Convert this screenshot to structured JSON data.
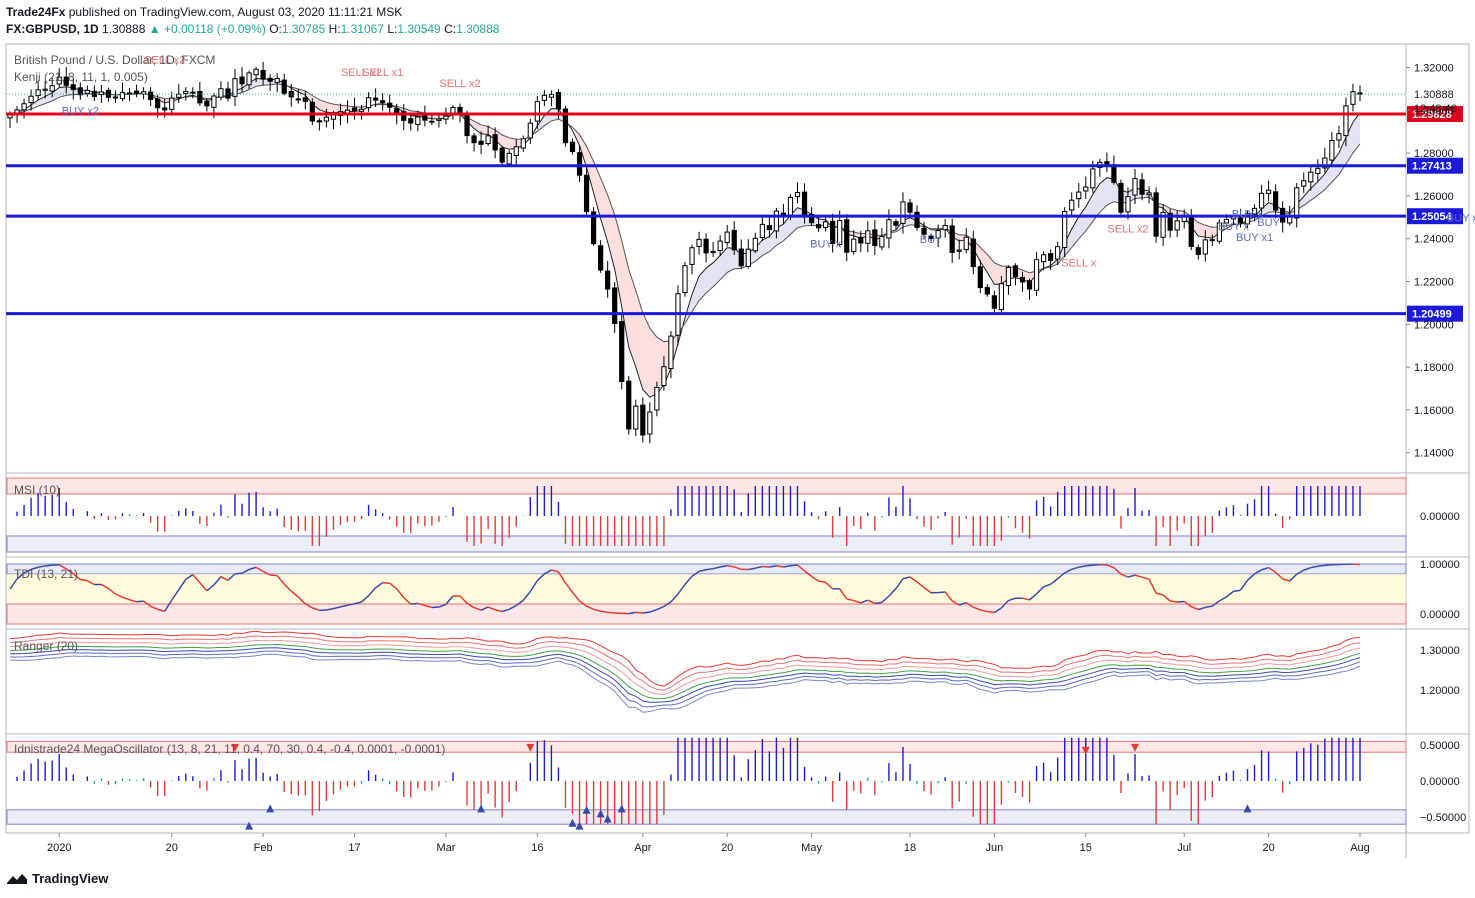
{
  "header": {
    "publisher": "Trade24Fx",
    "publish_text": "published on TradingView.com, August 03, 2020 11:11:21 MSK",
    "symbol": "FX:GBPUSD, 1D",
    "last": "1.30888",
    "change": "▲ +0.00118 (+0.09%)",
    "o_label": "O:",
    "o": "1.30785",
    "h_label": "H:",
    "h": "1.31067",
    "l_label": "L:",
    "l": "1.30549",
    "c_label": "C:",
    "c": "1.30888"
  },
  "main_pane": {
    "title": "British Pound / U.S. Dollar, 1D, FXCM",
    "indicator": "Kenji (21, 8, 11, 1, 0.005)",
    "countdown": "12:48:46"
  },
  "footer": {
    "brand": "TradingView"
  },
  "colors": {
    "up": "#26a69a",
    "red": "#e53935",
    "blue": "#1a1ad8",
    "candle": "#000000",
    "price_tag": "#1a1ad8",
    "red_tag": "#e0001b"
  },
  "chart_data": {
    "type": "candlestick",
    "symbol": "GBPUSD",
    "x_ticks": [
      "2020",
      "20",
      "Feb",
      "17",
      "Mar",
      "16",
      "Apr",
      "20",
      "May",
      "18",
      "Jun",
      "15",
      "Jul",
      "20",
      "Aug"
    ],
    "y_ticks": [
      "1.32000",
      "1.30000",
      "1.28000",
      "1.26000",
      "1.24000",
      "1.22000",
      "1.20000",
      "1.18000",
      "1.16000",
      "1.14000"
    ],
    "y_tick_values": [
      1.32,
      1.3,
      1.28,
      1.26,
      1.24,
      1.22,
      1.2,
      1.18,
      1.16,
      1.14
    ],
    "ylim": [
      1.131,
      1.331
    ],
    "current_price": "1.30888",
    "levels": [
      {
        "value": 1.29828,
        "label": "1.29828",
        "color": "#e0001b"
      },
      {
        "value": 1.27413,
        "label": "1.27413",
        "color": "#1a1ad8"
      },
      {
        "value": 1.25054,
        "label": "1.25054",
        "color": "#1a1ad8"
      },
      {
        "value": 1.20499,
        "label": "1.20499",
        "color": "#1a1ad8"
      }
    ],
    "signals": [
      {
        "text": "SELL x2",
        "i": 22,
        "price": 1.322,
        "color": "#e57373"
      },
      {
        "text": "SELL x2",
        "i": 50,
        "price": 1.316,
        "color": "#e57373"
      },
      {
        "text": "SELL x1",
        "i": 53,
        "price": 1.316,
        "color": "#e57373"
      },
      {
        "text": "SELL x2",
        "i": 64,
        "price": 1.311,
        "color": "#e57373"
      },
      {
        "text": "BUY x2",
        "i": 10,
        "price": 1.298,
        "color": "#5c6bc0"
      },
      {
        "text": "BUY x",
        "i": 116,
        "price": 1.236,
        "color": "#5c6bc0"
      },
      {
        "text": "BUY",
        "i": 131,
        "price": 1.238,
        "color": "#5c6bc0"
      },
      {
        "text": "SELL x2",
        "i": 159,
        "price": 1.243,
        "color": "#e57373"
      },
      {
        "text": "SELL x",
        "i": 152,
        "price": 1.227,
        "color": "#e57373"
      },
      {
        "text": "BUY x",
        "i": 174,
        "price": 1.244,
        "color": "#5c6bc0"
      },
      {
        "text": "BUY x",
        "i": 176,
        "price": 1.25,
        "color": "#5c6bc0"
      },
      {
        "text": "BUY",
        "i": 179,
        "price": 1.246,
        "color": "#5c6bc0"
      },
      {
        "text": "BUY x1",
        "i": 177,
        "price": 1.239,
        "color": "#5c6bc0"
      },
      {
        "text": "BUY x1",
        "i": 207,
        "price": 1.248,
        "color": "#5c6bc0"
      },
      {
        "text": "BUY x1",
        "i": 211,
        "price": 1.244,
        "color": "#5c6bc0"
      }
    ],
    "closes": [
      1.2985,
      1.3002,
      1.3031,
      1.3066,
      1.3096,
      1.3099,
      1.3115,
      1.3155,
      1.3117,
      1.3097,
      1.3073,
      1.3093,
      1.3065,
      1.3086,
      1.3061,
      1.3061,
      1.3083,
      1.3081,
      1.3078,
      1.3087,
      1.3051,
      1.3012,
      1.3002,
      1.3057,
      1.3075,
      1.3088,
      1.3082,
      1.3035,
      1.3021,
      1.3067,
      1.3101,
      1.3057,
      1.3148,
      1.3124,
      1.3175,
      1.3192,
      1.3146,
      1.3136,
      1.3149,
      1.308,
      1.3063,
      1.3049,
      1.3042,
      1.295,
      1.2946,
      1.2968,
      1.2983,
      1.2994,
      1.3001,
      1.2997,
      1.3005,
      1.3059,
      1.3048,
      1.3037,
      1.3014,
      1.2984,
      1.2953,
      1.2941,
      1.2969,
      1.2954,
      1.2949,
      1.2959,
      1.2973,
      1.3013,
      1.2983,
      1.2882,
      1.2849,
      1.2841,
      1.2881,
      1.2815,
      1.2758,
      1.2799,
      1.283,
      1.2867,
      1.294,
      1.3041,
      1.307,
      1.3074,
      1.3006,
      1.2849,
      1.2807,
      1.2697,
      1.2527,
      1.2377,
      1.2254,
      1.2165,
      1.2004,
      1.1733,
      1.1511,
      1.1618,
      1.1483,
      1.159,
      1.1705,
      1.1802,
      1.1945,
      1.2143,
      1.2274,
      1.2358,
      1.2397,
      1.2334,
      1.2341,
      1.2389,
      1.2431,
      1.2348,
      1.2274,
      1.2351,
      1.2402,
      1.2467,
      1.2443,
      1.2529,
      1.2505,
      1.2593,
      1.2616,
      1.2509,
      1.2475,
      1.2451,
      1.2479,
      1.2378,
      1.2485,
      1.2337,
      1.2398,
      1.238,
      1.2437,
      1.2368,
      1.2411,
      1.2489,
      1.2463,
      1.2572,
      1.2524,
      1.2453,
      1.2421,
      1.2401,
      1.2438,
      1.2462,
      1.2336,
      1.2347,
      1.2407,
      1.227,
      1.2172,
      1.2142,
      1.2075,
      1.219,
      1.2266,
      1.2223,
      1.2198,
      1.2165,
      1.2302,
      1.2325,
      1.2299,
      1.2363,
      1.2527,
      1.258,
      1.2618,
      1.2642,
      1.2726,
      1.2757,
      1.274,
      1.2664,
      1.2524,
      1.2597,
      1.2681,
      1.2608,
      1.2614,
      1.2412,
      1.2523,
      1.244,
      1.2484,
      1.2503,
      1.2364,
      1.2326,
      1.2395,
      1.2396,
      1.2474,
      1.249,
      1.2504,
      1.2473,
      1.2517,
      1.2542,
      1.2612,
      1.2627,
      1.2534,
      1.2478,
      1.2505,
      1.2638,
      1.2671,
      1.2711,
      1.2729,
      1.2777,
      1.2859,
      1.2891,
      1.3021,
      1.3087,
      1.3076
    ]
  },
  "msi": {
    "label": "MSI (10)",
    "ticks": [
      "0.00000"
    ]
  },
  "tdi": {
    "label": "TDI (13, 21)",
    "ticks": [
      "1.00000",
      "0.00000"
    ]
  },
  "ranger": {
    "label": "Ranger (20)",
    "ticks": [
      "1.30000",
      "1.20000"
    ]
  },
  "mega": {
    "label": "Idnistrade24 MegaOscillator (13, 8, 21, 11, 0.4, 70, 30, 0.4, -0.4, 0.0001, -0.0001)",
    "ticks": [
      "0.50000",
      "0.00000",
      "−0.50000"
    ]
  }
}
